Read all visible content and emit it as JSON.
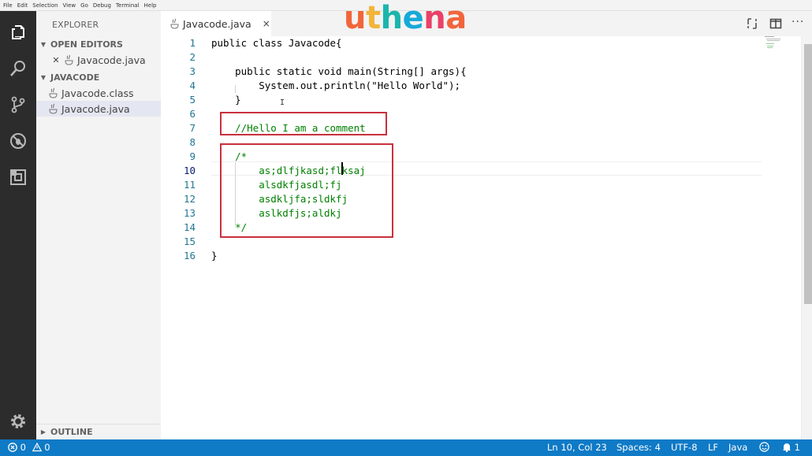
{
  "menu": [
    "File",
    "Edit",
    "Selection",
    "View",
    "Go",
    "Debug",
    "Terminal",
    "Help"
  ],
  "logo": {
    "u": "u",
    "t": "t",
    "h": "h",
    "e": "e",
    "n": "n",
    "a": "a"
  },
  "activity": [
    "explorer-icon",
    "search-icon",
    "source-control-icon",
    "debug-icon",
    "extensions-icon",
    "settings-gear-icon"
  ],
  "sidebar": {
    "title": "EXPLORER",
    "open_editors_label": "OPEN EDITORS",
    "open_editors": [
      {
        "name": "Javacode.java",
        "dirty_close": "✕"
      }
    ],
    "folder_label": "JAVACODE",
    "files": [
      {
        "name": "Javacode.class"
      },
      {
        "name": "Javacode.java"
      }
    ],
    "outline_label": "OUTLINE"
  },
  "tab": {
    "label": "Javacode.java",
    "close": "×"
  },
  "editor": {
    "line_numbers": [
      "1",
      "2",
      "3",
      "4",
      "5",
      "6",
      "7",
      "8",
      "9",
      "10",
      "11",
      "12",
      "13",
      "14",
      "15",
      "16"
    ],
    "active_line": "10",
    "lines": [
      "public class Javacode{",
      "",
      "    public static void main(String[] args){",
      "        System.out.println(\"Hello World\");",
      "    }",
      "",
      "    //Hello I am a comment",
      "",
      "    /*",
      "        as;dlfjkasd;flksaj",
      "        alsdkfjasdl;fj",
      "        asdkljfa;sldkfj",
      "        aslkdfjs;aldkj",
      "    */",
      "",
      "}"
    ]
  },
  "status": {
    "errors": "0",
    "warnings": "0",
    "position": "Ln 10, Col 23",
    "spaces": "Spaces: 4",
    "encoding": "UTF-8",
    "eol": "LF",
    "language": "Java",
    "notifications": "1"
  },
  "colors": {
    "statusbar": "#0f7ac6",
    "activitybar": "#2c2c2c",
    "comment": "#008000",
    "highlight_box": "#c9303d"
  }
}
